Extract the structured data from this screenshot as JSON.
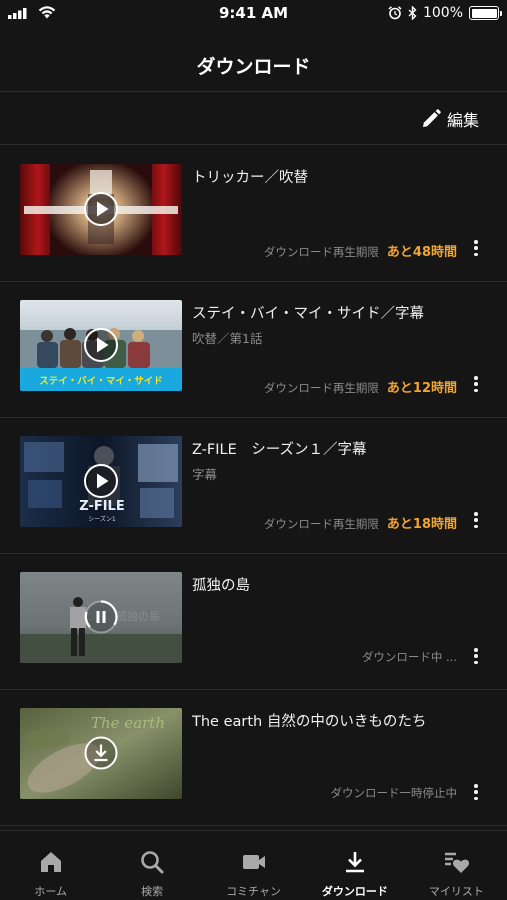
{
  "status_bar": {
    "time": "9:41 AM",
    "battery": "100%",
    "battery_level": 1.0
  },
  "header": {
    "title": "ダウンロード"
  },
  "toolbar": {
    "edit_label": "編集"
  },
  "downloads": [
    {
      "title": "トリッカー／吹替",
      "subtitle": "",
      "status": "ダウンロード再生期限",
      "remaining": "あと48時間",
      "control": "play-icon"
    },
    {
      "title": "ステイ・バイ・マイ・サイド／字幕",
      "subtitle": "吹替／第1話",
      "status": "ダウンロード再生期限",
      "remaining": "あと12時間",
      "control": "play-icon"
    },
    {
      "title": "Z-FILE　シーズン１／字幕",
      "subtitle": "字幕",
      "status": "ダウンロード再生期限",
      "remaining": "あと18時間",
      "control": "play-icon"
    },
    {
      "title": "孤独の島",
      "subtitle": "",
      "status": "ダウンロード中 ...",
      "remaining": "",
      "control": "pause-icon"
    },
    {
      "title": "The earth 自然の中のいきものたち",
      "subtitle": "",
      "status": "ダウンロード一時停止中",
      "remaining": "",
      "control": "download-icon"
    }
  ],
  "thumbnails": {
    "t2_caption": "ステイ・バイ・マイ・サイド",
    "t3_caption": "Z-FILE",
    "t3_sub": "シーズン1",
    "t4_caption": "孤独の島",
    "t5_caption": "The earth"
  },
  "tabs": [
    {
      "label": "ホーム",
      "icon": "home-icon",
      "active": false
    },
    {
      "label": "検索",
      "icon": "search-icon",
      "active": false
    },
    {
      "label": "コミチャン",
      "icon": "video-camera-icon",
      "active": false
    },
    {
      "label": "ダウンロード",
      "icon": "download-icon",
      "active": true
    },
    {
      "label": "マイリスト",
      "icon": "mylist-heart-icon",
      "active": false
    }
  ],
  "colors": {
    "background": "#151515",
    "accent": "#f0a431",
    "divider": "#2b2b2b",
    "secondary_text": "#8a8a8a"
  }
}
